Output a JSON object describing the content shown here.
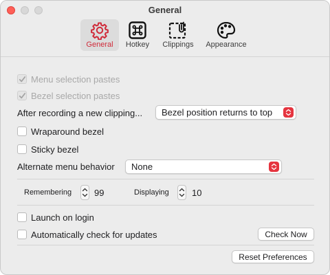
{
  "window": {
    "title": "General"
  },
  "tabs": [
    {
      "label": "General",
      "icon": "gear-icon",
      "selected": true
    },
    {
      "label": "Hotkey",
      "icon": "command-key-icon",
      "selected": false
    },
    {
      "label": "Clippings",
      "icon": "clippings-icon",
      "selected": false
    },
    {
      "label": "Appearance",
      "icon": "palette-icon",
      "selected": false
    }
  ],
  "options": {
    "menu_selection_pastes": "Menu selection pastes",
    "bezel_selection_pastes": "Bezel selection pastes",
    "after_recording_label": "After recording a new clipping...",
    "after_recording_value": "Bezel position returns to top",
    "wraparound_bezel": "Wraparound bezel",
    "sticky_bezel": "Sticky bezel",
    "alternate_menu_label": "Alternate menu behavior",
    "alternate_menu_value": "None"
  },
  "counts": {
    "remembering_label": "Remembering",
    "remembering_value": "99",
    "displaying_label": "Displaying",
    "displaying_value": "10"
  },
  "launch": {
    "launch_on_login": "Launch on login",
    "auto_check_updates": "Automatically check for updates",
    "check_now": "Check Now"
  },
  "footer": {
    "reset_preferences": "Reset Preferences"
  },
  "colors": {
    "accent": "#d02a39",
    "popup_arrow": "#e5343f",
    "close": "#ff5f57"
  }
}
